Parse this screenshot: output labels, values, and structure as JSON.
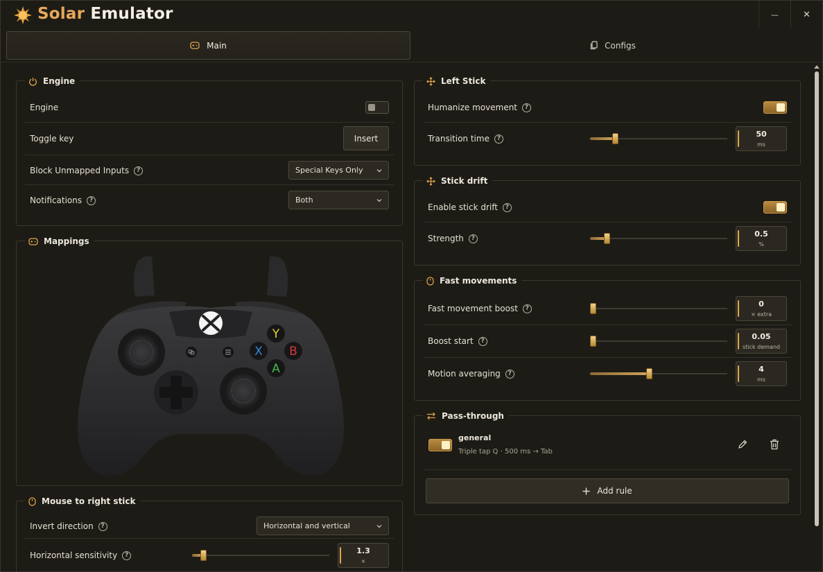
{
  "app": {
    "title_part1": "Solar",
    "title_part2": " Emulator"
  },
  "window_controls": {
    "minimize": "—",
    "close": "✕"
  },
  "tabs": [
    {
      "label": "Main",
      "icon": "gamepad-icon",
      "active": true
    },
    {
      "label": "Configs",
      "icon": "copy-icon",
      "active": false
    }
  ],
  "engine_panel": {
    "title": "Engine",
    "rows": {
      "engine": {
        "label": "Engine",
        "enabled": false
      },
      "toggle_key": {
        "label": "Toggle key",
        "value": "Insert"
      },
      "block_unmapped": {
        "label": "Block Unmapped Inputs",
        "value": "Special Keys Only"
      },
      "notifications": {
        "label": "Notifications",
        "value": "Both"
      }
    }
  },
  "mappings_panel": {
    "title": "Mappings",
    "buttons": {
      "y": "Y",
      "x": "X",
      "b": "B",
      "a": "A"
    }
  },
  "mouse_panel": {
    "title": "Mouse to right stick",
    "invert": {
      "label": "Invert direction",
      "value": "Horizontal and vertical"
    },
    "hsens": {
      "label": "Horizontal sensitivity",
      "value": "1.3",
      "unit": "×",
      "fraction": 0.08
    }
  },
  "left_stick_panel": {
    "title": "Left Stick",
    "humanize": {
      "label": "Humanize movement",
      "enabled": true
    },
    "transition": {
      "label": "Transition time",
      "value": "50",
      "unit": "ms",
      "fraction": 0.18
    }
  },
  "drift_panel": {
    "title": "Stick drift",
    "enable": {
      "label": "Enable stick drift",
      "enabled": true
    },
    "strength": {
      "label": "Strength",
      "value": "0.5",
      "unit": "%",
      "fraction": 0.12
    }
  },
  "fast_panel": {
    "title": "Fast movements",
    "boost": {
      "label": "Fast movement boost",
      "value": "0",
      "unit": "× extra",
      "fraction": 0.02
    },
    "boost_start": {
      "label": "Boost start",
      "value": "0.05",
      "unit": "stick demand",
      "fraction": 0.02
    },
    "averaging": {
      "label": "Motion averaging",
      "value": "4",
      "unit": "ms",
      "fraction": 0.43
    }
  },
  "pass_panel": {
    "title": "Pass-through",
    "rule": {
      "name": "general",
      "desc": "Triple tap Q · 500 ms → Tab",
      "enabled": true
    },
    "add_label": "Add rule"
  },
  "colors": {
    "accent": "#e0a64a",
    "bg": "#1d1b15",
    "border": "#3b372d"
  }
}
